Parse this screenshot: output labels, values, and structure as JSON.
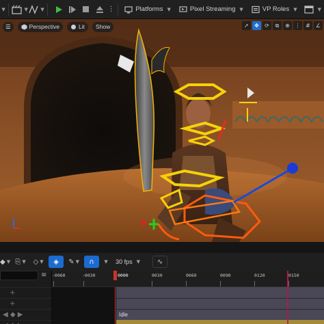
{
  "toolbar": {
    "platforms_label": "Platforms",
    "pixel_streaming_label": "Pixel Streaming",
    "vp_roles_label": "VP Roles"
  },
  "viewport": {
    "perspective_label": "Perspective",
    "lit_label": "Lit",
    "show_label": "Show"
  },
  "sequencer": {
    "fps_label": "30 fps",
    "playhead_frame": "0000",
    "ticks": [
      "-0060",
      "-0030",
      "0000",
      "0030",
      "0060",
      "0090",
      "0120",
      "0150"
    ],
    "section_label": "Idle"
  },
  "colors": {
    "accent_blue": "#1c6bd0",
    "gizmo_yellow": "#f5d20a",
    "gizmo_orange": "#ff5a10",
    "gizmo_blue": "#1a4bd8",
    "playhead_red": "#d0302a",
    "end_marker": "#b0184a"
  }
}
